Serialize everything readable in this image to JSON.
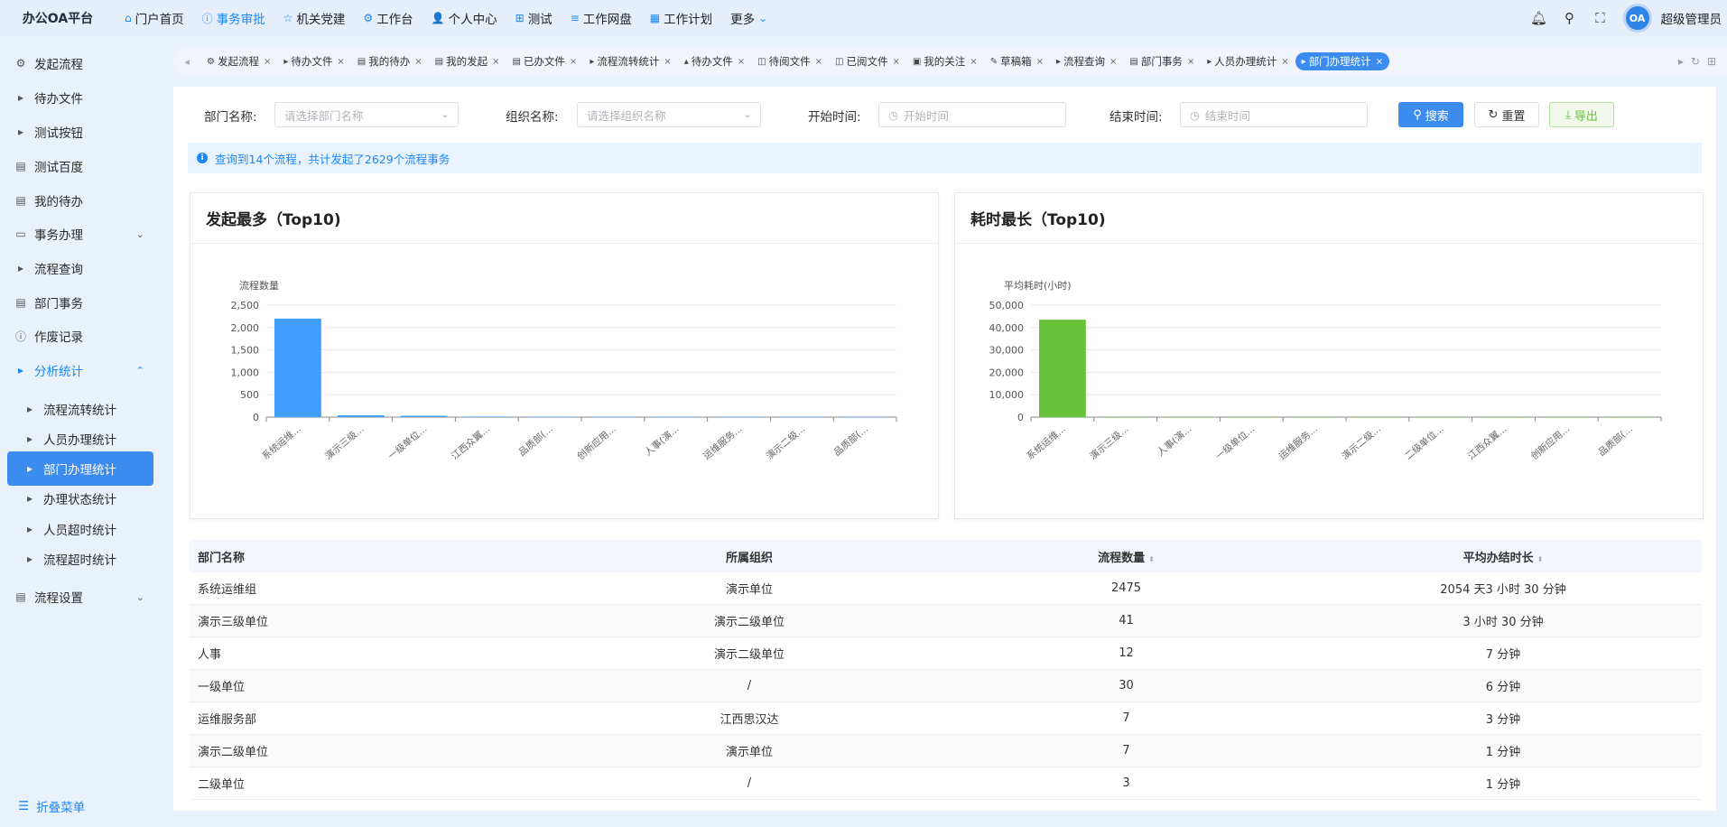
{
  "app": {
    "title": "办公OA平台"
  },
  "topnav": [
    {
      "icon": "home-icon",
      "glyph": "⌂",
      "label": "门户首页",
      "active": false
    },
    {
      "icon": "info-icon",
      "glyph": "ⓘ",
      "label": "事务审批",
      "active": true
    },
    {
      "icon": "star-icon",
      "glyph": "☆",
      "label": "机关党建",
      "active": false
    },
    {
      "icon": "workflow-icon",
      "glyph": "⚙",
      "label": "工作台",
      "active": false
    },
    {
      "icon": "user-icon",
      "glyph": "👤",
      "label": "个人中心",
      "active": false
    },
    {
      "icon": "grid-icon",
      "glyph": "⊞",
      "label": "测试",
      "active": false
    },
    {
      "icon": "database-icon",
      "glyph": "≡",
      "label": "工作网盘",
      "active": false
    },
    {
      "icon": "calendar-icon",
      "glyph": "▦",
      "label": "工作计划",
      "active": false
    },
    {
      "icon": "chevron-down-icon",
      "glyph": "⌄",
      "label": "更多",
      "active": false
    }
  ],
  "user": {
    "name": "超级管理员",
    "avatar_text": "OA"
  },
  "sidebar": {
    "items": [
      {
        "label": "发起流程",
        "icon": "flow-icon",
        "glyph": "⚙",
        "sub": false,
        "active": false,
        "blue": false,
        "chevron": ""
      },
      {
        "label": "待办文件",
        "icon": "caret-right-icon",
        "glyph": "▸",
        "sub": false,
        "active": false,
        "blue": false,
        "chevron": ""
      },
      {
        "label": "测试按钮",
        "icon": "caret-right-icon",
        "glyph": "▸",
        "sub": false,
        "active": false,
        "blue": false,
        "chevron": ""
      },
      {
        "label": "测试百度",
        "icon": "document-icon",
        "glyph": "▤",
        "sub": false,
        "active": false,
        "blue": false,
        "chevron": ""
      },
      {
        "label": "我的待办",
        "icon": "document-icon",
        "glyph": "▤",
        "sub": false,
        "active": false,
        "blue": false,
        "chevron": ""
      },
      {
        "label": "事务办理",
        "icon": "folder-icon",
        "glyph": "▭",
        "sub": false,
        "active": false,
        "blue": false,
        "chevron": "⌄"
      },
      {
        "label": "流程查询",
        "icon": "caret-right-icon",
        "glyph": "▸",
        "sub": false,
        "active": false,
        "blue": false,
        "chevron": ""
      },
      {
        "label": "部门事务",
        "icon": "document-icon",
        "glyph": "▤",
        "sub": false,
        "active": false,
        "blue": false,
        "chevron": ""
      },
      {
        "label": "作废记录",
        "icon": "info-icon",
        "glyph": "ⓘ",
        "sub": false,
        "active": false,
        "blue": false,
        "chevron": ""
      },
      {
        "label": "分析统计",
        "icon": "caret-right-icon",
        "glyph": "▸",
        "sub": false,
        "active": false,
        "blue": true,
        "chevron": "⌃"
      },
      {
        "label": "流程流转统计",
        "icon": "caret-right-icon",
        "glyph": "▸",
        "sub": true,
        "active": false,
        "blue": false,
        "chevron": ""
      },
      {
        "label": "人员办理统计",
        "icon": "caret-right-icon",
        "glyph": "▸",
        "sub": true,
        "active": false,
        "blue": false,
        "chevron": ""
      },
      {
        "label": "部门办理统计",
        "icon": "caret-right-icon",
        "glyph": "▸",
        "sub": true,
        "active": true,
        "blue": false,
        "chevron": ""
      },
      {
        "label": "办理状态统计",
        "icon": "caret-right-icon",
        "glyph": "▸",
        "sub": true,
        "active": false,
        "blue": false,
        "chevron": ""
      },
      {
        "label": "人员超时统计",
        "icon": "caret-right-icon",
        "glyph": "▸",
        "sub": true,
        "active": false,
        "blue": false,
        "chevron": ""
      },
      {
        "label": "流程超时统计",
        "icon": "caret-right-icon",
        "glyph": "▸",
        "sub": true,
        "active": false,
        "blue": false,
        "chevron": ""
      },
      {
        "label": "流程设置",
        "icon": "document-icon",
        "glyph": "▤",
        "sub": false,
        "active": false,
        "blue": false,
        "chevron": "⌄"
      }
    ],
    "collapse_label": "折叠菜单"
  },
  "tabs": [
    {
      "label": "发起流程",
      "icon": "flow-icon",
      "glyph": "⚙",
      "active": false
    },
    {
      "label": "待办文件",
      "icon": "caret-right-icon",
      "glyph": "▸",
      "active": false
    },
    {
      "label": "我的待办",
      "icon": "document-icon",
      "glyph": "▤",
      "active": false
    },
    {
      "label": "我的发起",
      "icon": "document-icon",
      "glyph": "▤",
      "active": false
    },
    {
      "label": "已办文件",
      "icon": "document-icon",
      "glyph": "▤",
      "active": false
    },
    {
      "label": "流程流转统计",
      "icon": "caret-right-icon",
      "glyph": "▸",
      "active": false
    },
    {
      "label": "待办文件",
      "icon": "user-icon",
      "glyph": "▴",
      "active": false
    },
    {
      "label": "待阅文件",
      "icon": "book-icon",
      "glyph": "◫",
      "active": false
    },
    {
      "label": "已阅文件",
      "icon": "book-icon",
      "glyph": "◫",
      "active": false
    },
    {
      "label": "我的关注",
      "icon": "printer-icon",
      "glyph": "▣",
      "active": false
    },
    {
      "label": "草稿箱",
      "icon": "edit-icon",
      "glyph": "✎",
      "active": false
    },
    {
      "label": "流程查询",
      "icon": "caret-right-icon",
      "glyph": "▸",
      "active": false
    },
    {
      "label": "部门事务",
      "icon": "document-icon",
      "glyph": "▤",
      "active": false
    },
    {
      "label": "人员办理统计",
      "icon": "caret-right-icon",
      "glyph": "▸",
      "active": false
    },
    {
      "label": "部门办理统计",
      "icon": "caret-right-icon",
      "glyph": "▸",
      "active": true
    }
  ],
  "tab_close": "×",
  "filters": {
    "dept_label": "部门名称:",
    "dept_placeholder": "请选择部门名称",
    "org_label": "组织名称:",
    "org_placeholder": "请选择组织名称",
    "start_label": "开始时间:",
    "start_placeholder": "开始时间",
    "end_label": "结束时间:",
    "end_placeholder": "结束时间",
    "search_label": "搜索",
    "reset_label": "重置",
    "export_label": "导出"
  },
  "alert": {
    "text": "查询到14个流程，共计发起了2629个流程事务"
  },
  "chart_data": [
    {
      "type": "bar",
      "title": "发起最多（Top10)",
      "ylabel": "流程数量",
      "color": "#409eff",
      "categories": [
        "系统运维...",
        "演示三级...",
        "一级单位...",
        "江西众翼...",
        "品质部(...",
        "创新应用...",
        "人事(演...",
        "运维服务...",
        "演示二级...",
        "品质部(..."
      ],
      "values": [
        2200,
        41,
        30,
        12,
        10,
        8,
        7,
        7,
        5,
        3
      ],
      "yticks": [
        0,
        500,
        1000,
        1500,
        2000,
        2500
      ],
      "ytick_labels": [
        "0",
        "500",
        "1,000",
        "1,500",
        "2,000",
        "2,500"
      ],
      "ylim": [
        0,
        2500
      ]
    },
    {
      "type": "bar",
      "title": "耗时最长（Top10)",
      "ylabel": "平均耗时(小时)",
      "color": "#67c23a",
      "categories": [
        "系统运维...",
        "演示三级...",
        "人事(演...",
        "一级单位...",
        "运维服务...",
        "演示二级...",
        "二级单位...",
        "江西众翼...",
        "创新应用...",
        "品质部(..."
      ],
      "values": [
        43500,
        3.5,
        0.12,
        0.1,
        0.05,
        0.02,
        0.02,
        0.01,
        0.01,
        0.01
      ],
      "yticks": [
        0,
        10000,
        20000,
        30000,
        40000,
        50000
      ],
      "ytick_labels": [
        "0",
        "10,000",
        "20,000",
        "30,000",
        "40,000",
        "50,000"
      ],
      "ylim": [
        0,
        50000
      ]
    }
  ],
  "table": {
    "headers": [
      "部门名称",
      "所属组织",
      "流程数量",
      "平均办结时长"
    ],
    "rows": [
      [
        "系统运维组",
        "演示单位",
        "2475",
        "2054 天3 小时 30 分钟"
      ],
      [
        "演示三级单位",
        "演示二级单位",
        "41",
        "3 小时 30 分钟"
      ],
      [
        "人事",
        "演示二级单位",
        "12",
        "7 分钟"
      ],
      [
        "一级单位",
        "/",
        "30",
        "6 分钟"
      ],
      [
        "运维服务部",
        "江西思汉达",
        "7",
        "3 分钟"
      ],
      [
        "演示二级单位",
        "演示单位",
        "7",
        "1 分钟"
      ],
      [
        "二级单位",
        "/",
        "3",
        "1 分钟"
      ]
    ]
  }
}
